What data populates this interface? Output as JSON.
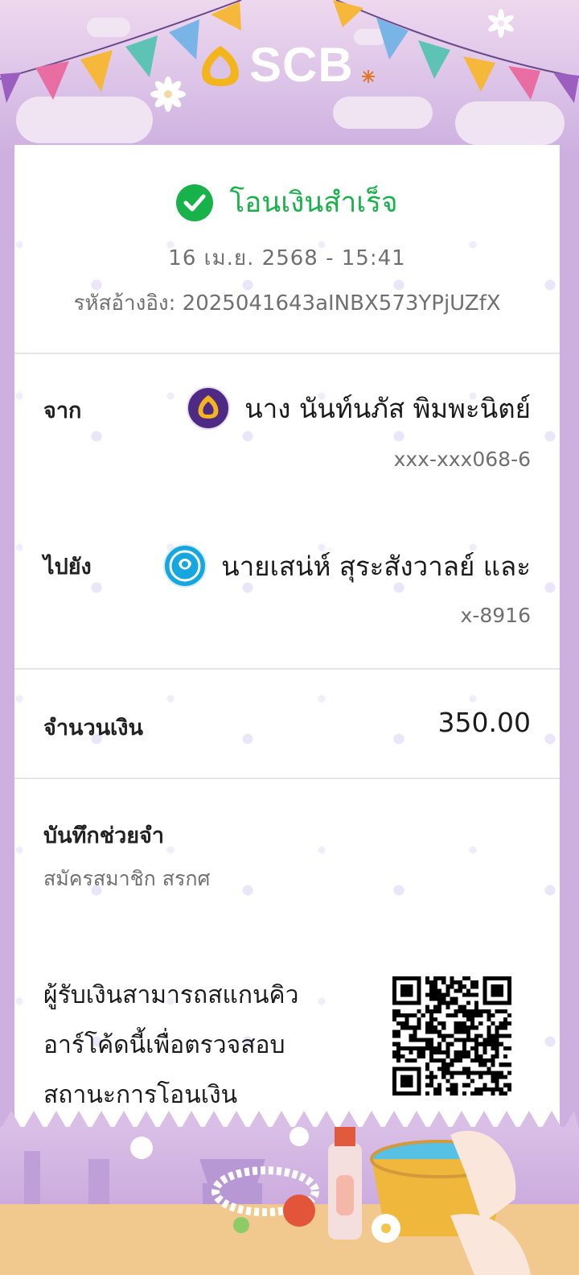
{
  "brand": {
    "name": "SCB"
  },
  "status": {
    "text": "โอนเงินสำเร็จ"
  },
  "datetime": "16 เม.ย. 2568 - 15:41",
  "reference": "รหัสอ้างอิง: 2025041643aINBX573YPjUZfX",
  "from": {
    "label": "จาก",
    "name": "นาง นันท์นภัส พิมพะนิตย์",
    "account": "xxx-xxx068-6",
    "bank_icon": "scb-icon"
  },
  "to": {
    "label": "ไปยัง",
    "name": "นายเสน่ห์ สุระสังวาลย์ และ",
    "account": "x-8916",
    "bank_icon": "ktb-icon"
  },
  "amount": {
    "label": "จำนวนเงิน",
    "value": "350.00"
  },
  "memo": {
    "label": "บันทึกช่วยจำ",
    "value": "สมัครสมาชิก สรกศ"
  },
  "qr": {
    "note_lines": [
      "ผู้รับเงินสามารถสแกนคิว",
      "อาร์โค้ดนี้เพื่อตรวจสอบ",
      "สถานะการโอนเงิน"
    ]
  },
  "colors": {
    "success": "#17b24a",
    "scb_purple": "#4e2a84",
    "scb_gold": "#f2b51b",
    "ktb_blue": "#16a7e0",
    "frame_lilac": "#cdb0df"
  }
}
